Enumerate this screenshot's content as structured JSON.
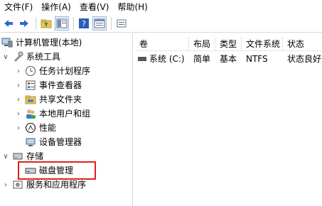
{
  "menu": {
    "file": "文件(F)",
    "action": "操作(A)",
    "view": "查看(V)",
    "help": "帮助(H)"
  },
  "toolbar": {
    "icons": [
      "back-arrow-icon",
      "forward-arrow-icon",
      "folder-up-icon",
      "show-tree-icon",
      "help-icon",
      "properties-icon",
      "export-list-icon"
    ]
  },
  "tree": {
    "root": "计算机管理(本地)",
    "system_tools": "系统工具",
    "task_scheduler": "任务计划程序",
    "event_viewer": "事件查看器",
    "shared_folders": "共享文件夹",
    "local_users_groups": "本地用户和组",
    "performance": "性能",
    "device_manager": "设备管理器",
    "storage": "存储",
    "disk_management": "磁盘管理",
    "services_apps": "服务和应用程序"
  },
  "list": {
    "columns": [
      "卷",
      "布局",
      "类型",
      "文件系统",
      "状态"
    ],
    "rows": [
      {
        "volume": "系统 (C:)",
        "layout": "简单",
        "type": "基本",
        "fs": "NTFS",
        "status": "状态良好 ("
      }
    ]
  },
  "colors": {
    "highlight_border": "#e02020",
    "divider": "#d9d9d9"
  }
}
